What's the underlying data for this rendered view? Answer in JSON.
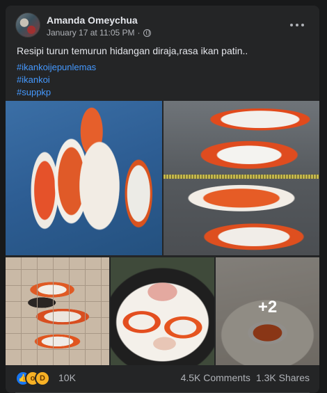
{
  "post": {
    "author": "Amanda Omeychua",
    "timestamp": "January 17 at 11:05 PM",
    "privacy_icon": "globe-icon",
    "caption": "Resipi turun temurun hidangan diraja,rasa ikan patin..",
    "hashtags": [
      "#ikankoijepunlemas",
      "#ikankoi",
      "#suppkp"
    ],
    "more_photos": "+2",
    "reaction_icons": [
      "like-icon",
      "wow-icon",
      "haha-icon"
    ],
    "reaction_count": "10K",
    "comments": "4.5K Comments",
    "shares": "1.3K Shares"
  },
  "colors": {
    "background": "#18191a",
    "card": "#242526",
    "text": "#e4e6eb",
    "secondary_text": "#b0b3b8",
    "link": "#4599ff",
    "like_blue": "#1877f2",
    "emoji_yellow": "#f7b125"
  }
}
